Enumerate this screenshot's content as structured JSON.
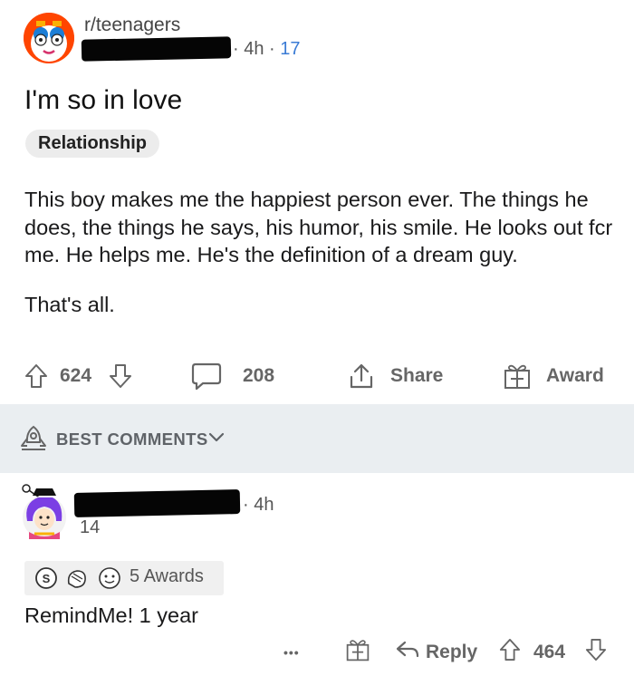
{
  "post": {
    "subreddit": "r/teenagers",
    "age": "4h",
    "separator": "·",
    "comment_count_meta": "17",
    "title": "I'm so in love",
    "flair": "Relationship",
    "body_paragraphs": [
      "This boy makes me the happiest person ever. The things he does, the things he says, his humor, his smile. He looks out fcr me. He helps me. He's the definition of a dream guy.",
      "That's all."
    ],
    "upvotes": "624",
    "comments": "208",
    "share_label": "Share",
    "award_label": "Award"
  },
  "best_comments": {
    "label": "BEST COMMENTS"
  },
  "comment": {
    "age": "4h",
    "score": "14",
    "awards_label": "5 Awards",
    "text": "RemindMe! 1 year",
    "more_label": "•••",
    "reply_label": "Reply",
    "votes": "464"
  },
  "colors": {
    "subreddit_avatar_bg": "#ff4500",
    "band_bg": "#eaeef1",
    "link_blue": "#3a7bd5",
    "muted_text": "#666666"
  },
  "icons": {
    "upvote": "arrow-up-icon",
    "downvote": "arrow-down-icon",
    "comment": "speech-bubble-icon",
    "share": "share-icon",
    "award": "gift-icon",
    "best": "rocket-icon",
    "chevron": "chevron-down-icon",
    "reply": "reply-arrow-icon",
    "more": "ellipsis-icon"
  }
}
